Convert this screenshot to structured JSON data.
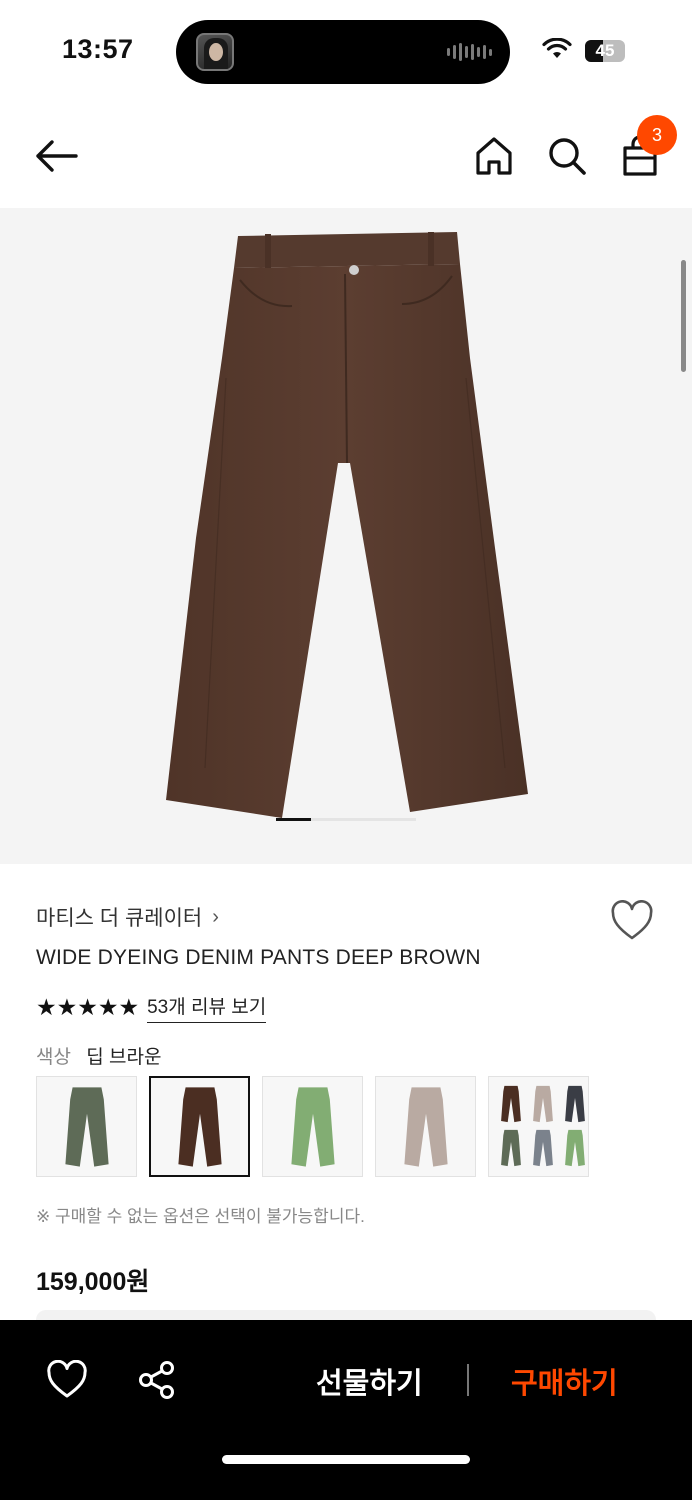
{
  "status_bar": {
    "time": "13:57",
    "battery_level": "45",
    "battery_fraction": 0.45
  },
  "nav": {
    "cart_count": "3",
    "icons": [
      "back-arrow-icon",
      "home-icon",
      "search-icon",
      "shopping-bag-icon"
    ]
  },
  "gallery": {
    "current_index": 1,
    "total": 4
  },
  "product": {
    "brand": "마티스 더 큐레이터",
    "brand_chevron": "›",
    "name": "WIDE DYEING DENIM PANTS DEEP BROWN",
    "rating_stars": "★★★★★",
    "rating": 5,
    "review_link": "53개 리뷰 보기",
    "color_label": "색상",
    "color_value": "딥 브라운",
    "notice": "※ 구매할 수 없는 옵션은 선택이 불가능합니다.",
    "price": "159,000원",
    "swatches": [
      {
        "color": "#5e6b57",
        "selected": false
      },
      {
        "color": "#4b2e22",
        "selected": true
      },
      {
        "color": "#82ad73",
        "selected": false
      },
      {
        "color": "#b9aaa2",
        "selected": false
      },
      {
        "colors": [
          "#4b2e22",
          "#b9aaa2",
          "#3a3d45",
          "#5e6b57",
          "#7b828c",
          "#82ad73"
        ],
        "selected": false
      }
    ]
  },
  "bottom_bar": {
    "gift_label": "선물하기",
    "buy_label": "구매하기"
  },
  "colors": {
    "accent": "#ff4800",
    "product_brown": "#5a3c30",
    "background": "#ffffff",
    "bottom_bar": "#000000"
  }
}
